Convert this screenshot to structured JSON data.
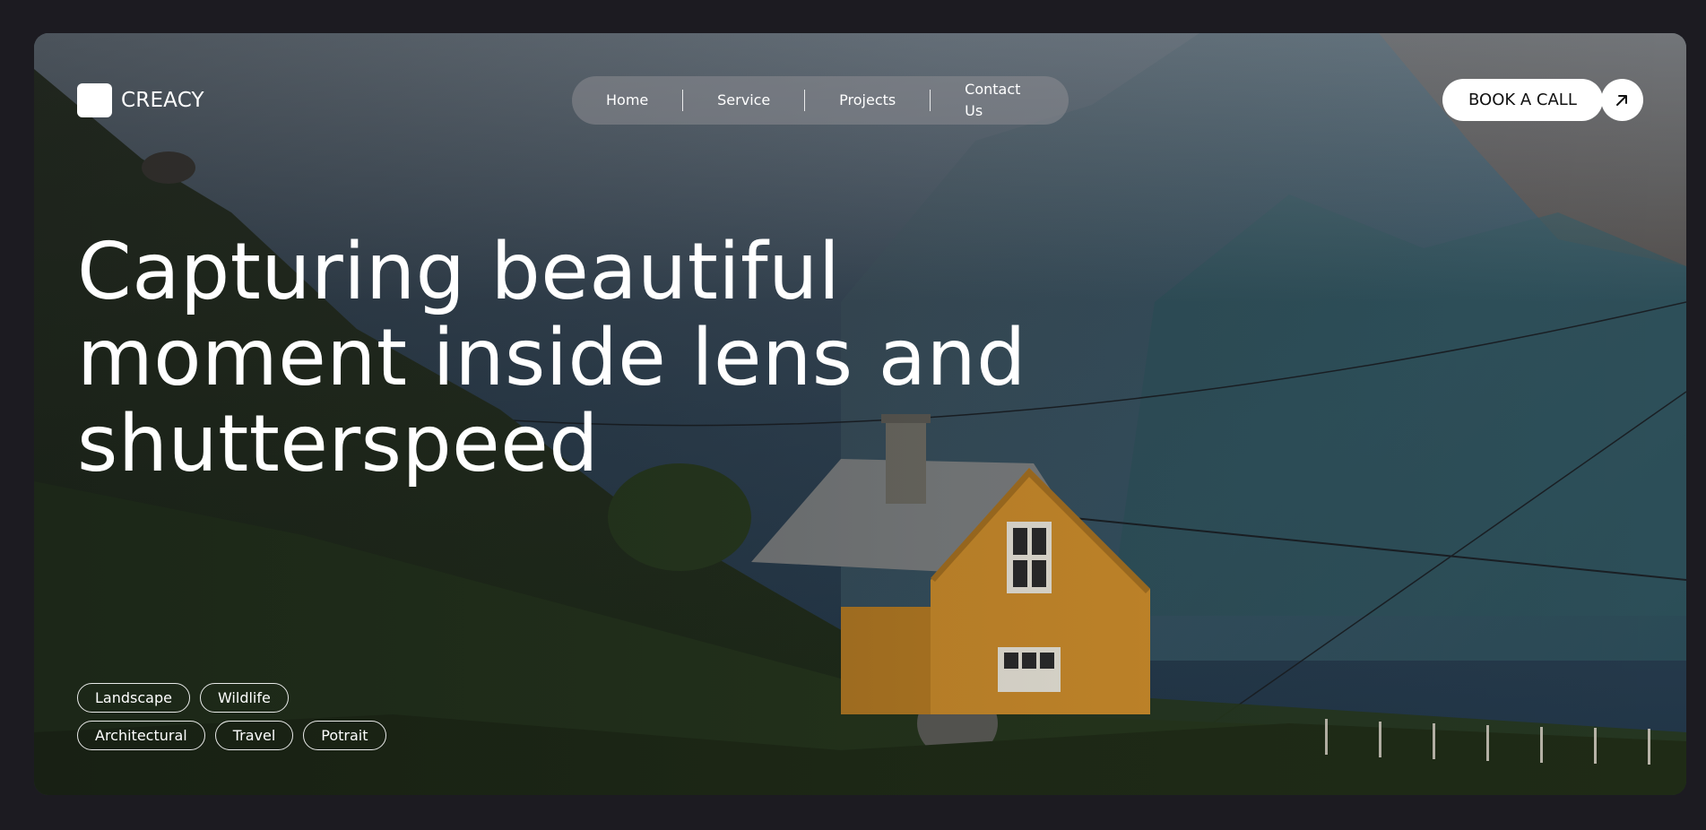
{
  "brand": {
    "name": "CREACY"
  },
  "nav": {
    "items": [
      {
        "label": "Home"
      },
      {
        "label": "Service"
      },
      {
        "label": "Projects"
      },
      {
        "label": "Contact Us"
      }
    ]
  },
  "cta": {
    "label": "BOOK A CALL",
    "icon": "arrow-up-right-icon"
  },
  "hero": {
    "headline_lines": [
      "Capturing beautiful",
      "moment inside lens and",
      "shutterspeed"
    ],
    "background": "landscape photo: mountain hillside with yellow wooden house under cloudy sky"
  },
  "tags": {
    "row1": [
      "Landscape",
      "Wildlife"
    ],
    "row2": [
      "Architectural",
      "Travel",
      "Potrait"
    ]
  },
  "colors": {
    "page_bg": "#1c1b21",
    "house": "#c98a2a",
    "accent_white": "#ffffff"
  }
}
